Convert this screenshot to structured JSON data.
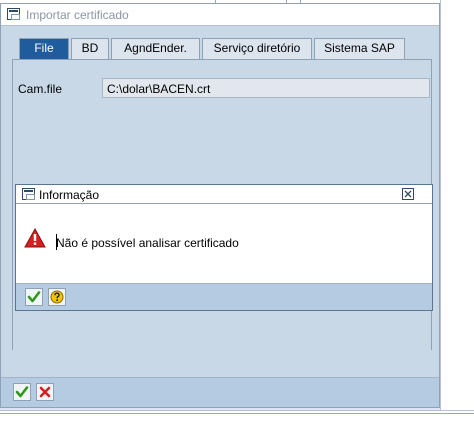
{
  "window": {
    "title": "Importar certificado",
    "icon": "window-icon"
  },
  "tabs": [
    {
      "label": "File",
      "active": true
    },
    {
      "label": "BD",
      "active": false
    },
    {
      "label": "AgndEnder.",
      "active": false
    },
    {
      "label": "Serviço diretório",
      "active": false
    },
    {
      "label": "Sistema SAP",
      "active": false
    }
  ],
  "file_tab": {
    "field_label": "Cam.file",
    "field_value": "C:\\dolar\\BACEN.crt"
  },
  "info_popup": {
    "title": "Informação",
    "message": "Não é possível analisar certificado",
    "icons": {
      "message": "error-triangle-icon",
      "close": "close-icon"
    },
    "buttons": [
      {
        "icon": "check-icon"
      },
      {
        "icon": "help-icon"
      }
    ]
  },
  "dialog_buttons": [
    {
      "icon": "check-icon"
    },
    {
      "icon": "cancel-x-icon"
    }
  ],
  "colors": {
    "active_tab": "#1f5c9e",
    "panel": "#c8d8e7",
    "button_bar": "#b4cbe1",
    "error_red": "#d42020"
  }
}
